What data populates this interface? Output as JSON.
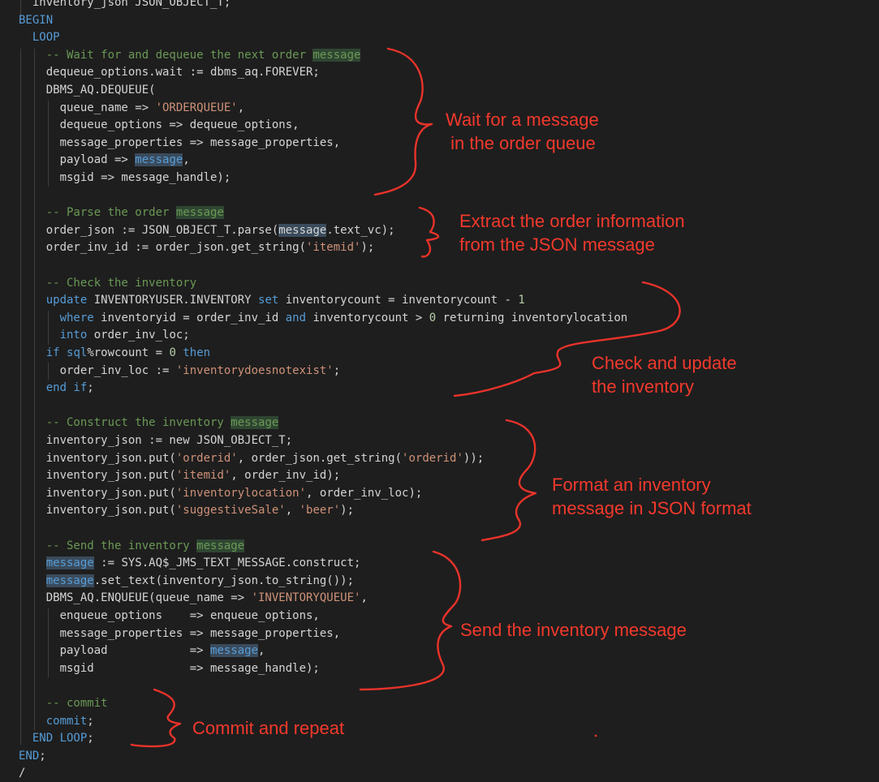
{
  "editor": {
    "lines": [
      [
        {
          "t": "  inventory_json JSON_OBJECT_T;",
          "c": ""
        }
      ],
      [
        {
          "t": "BEGIN",
          "c": "kw"
        }
      ],
      [
        {
          "t": "  ",
          "c": ""
        },
        {
          "t": "LOOP",
          "c": "kw"
        }
      ],
      [
        {
          "t": "    -- Wait for and dequeue the next order ",
          "c": "cm"
        },
        {
          "t": "message",
          "c": "cm hlc"
        }
      ],
      [
        {
          "t": "    dequeue_options.wait := dbms_aq.FOREVER;",
          "c": ""
        }
      ],
      [
        {
          "t": "    DBMS_AQ.DEQUEUE(",
          "c": ""
        }
      ],
      [
        {
          "t": "      queue_name => ",
          "c": ""
        },
        {
          "t": "'ORDERQUEUE'",
          "c": "str"
        },
        {
          "t": ",",
          "c": ""
        }
      ],
      [
        {
          "t": "      dequeue_options => dequeue_options,",
          "c": ""
        }
      ],
      [
        {
          "t": "      message_properties => message_properties,",
          "c": ""
        }
      ],
      [
        {
          "t": "      payload => ",
          "c": ""
        },
        {
          "t": "message",
          "c": "kw hl"
        },
        {
          "t": ",",
          "c": ""
        }
      ],
      [
        {
          "t": "      msgid => message_handle);",
          "c": ""
        }
      ],
      [
        {
          "t": "",
          "c": ""
        }
      ],
      [
        {
          "t": "    -- Parse the order ",
          "c": "cm"
        },
        {
          "t": "message",
          "c": "cm hlc"
        }
      ],
      [
        {
          "t": "    order_json := JSON_OBJECT_T.parse(",
          "c": ""
        },
        {
          "t": "message",
          "c": "hl"
        },
        {
          "t": ".text_vc);",
          "c": ""
        }
      ],
      [
        {
          "t": "    order_inv_id := order_json.get_string(",
          "c": ""
        },
        {
          "t": "'itemid'",
          "c": "str"
        },
        {
          "t": ");",
          "c": ""
        }
      ],
      [
        {
          "t": "",
          "c": ""
        }
      ],
      [
        {
          "t": "    -- Check the inventory",
          "c": "cm"
        }
      ],
      [
        {
          "t": "    ",
          "c": ""
        },
        {
          "t": "update",
          "c": "kw"
        },
        {
          "t": " INVENTORYUSER.INVENTORY ",
          "c": ""
        },
        {
          "t": "set",
          "c": "kw"
        },
        {
          "t": " inventorycount = inventorycount - ",
          "c": ""
        },
        {
          "t": "1",
          "c": "num"
        }
      ],
      [
        {
          "t": "      ",
          "c": ""
        },
        {
          "t": "where",
          "c": "kw"
        },
        {
          "t": " inventoryid = order_inv_id ",
          "c": ""
        },
        {
          "t": "and",
          "c": "kw"
        },
        {
          "t": " inventorycount > ",
          "c": ""
        },
        {
          "t": "0",
          "c": "num"
        },
        {
          "t": " returning inventorylocation",
          "c": ""
        }
      ],
      [
        {
          "t": "      ",
          "c": ""
        },
        {
          "t": "into",
          "c": "kw"
        },
        {
          "t": " order_inv_loc;",
          "c": ""
        }
      ],
      [
        {
          "t": "    ",
          "c": ""
        },
        {
          "t": "if",
          "c": "kw"
        },
        {
          "t": " ",
          "c": ""
        },
        {
          "t": "sql",
          "c": "kw"
        },
        {
          "t": "%rowcount = ",
          "c": ""
        },
        {
          "t": "0",
          "c": "num"
        },
        {
          "t": " ",
          "c": ""
        },
        {
          "t": "then",
          "c": "kw"
        }
      ],
      [
        {
          "t": "      order_inv_loc := ",
          "c": ""
        },
        {
          "t": "'inventorydoesnotexist'",
          "c": "str"
        },
        {
          "t": ";",
          "c": ""
        }
      ],
      [
        {
          "t": "    ",
          "c": ""
        },
        {
          "t": "end if",
          "c": "kw"
        },
        {
          "t": ";",
          "c": ""
        }
      ],
      [
        {
          "t": "",
          "c": ""
        }
      ],
      [
        {
          "t": "    -- Construct the inventory ",
          "c": "cm"
        },
        {
          "t": "message",
          "c": "cm hlc"
        }
      ],
      [
        {
          "t": "    inventory_json := new JSON_OBJECT_T;",
          "c": ""
        }
      ],
      [
        {
          "t": "    inventory_json.put(",
          "c": ""
        },
        {
          "t": "'orderid'",
          "c": "str"
        },
        {
          "t": ", order_json.get_string(",
          "c": ""
        },
        {
          "t": "'orderid'",
          "c": "str"
        },
        {
          "t": "));",
          "c": ""
        }
      ],
      [
        {
          "t": "    inventory_json.put(",
          "c": ""
        },
        {
          "t": "'itemid'",
          "c": "str"
        },
        {
          "t": ", order_inv_id);",
          "c": ""
        }
      ],
      [
        {
          "t": "    inventory_json.put(",
          "c": ""
        },
        {
          "t": "'inventorylocation'",
          "c": "str"
        },
        {
          "t": ", order_inv_loc);",
          "c": ""
        }
      ],
      [
        {
          "t": "    inventory_json.put(",
          "c": ""
        },
        {
          "t": "'suggestiveSale'",
          "c": "str"
        },
        {
          "t": ", ",
          "c": ""
        },
        {
          "t": "'beer'",
          "c": "str"
        },
        {
          "t": ");",
          "c": ""
        }
      ],
      [
        {
          "t": "",
          "c": ""
        }
      ],
      [
        {
          "t": "    -- Send the inventory ",
          "c": "cm"
        },
        {
          "t": "message",
          "c": "cm hlc"
        }
      ],
      [
        {
          "t": "    ",
          "c": ""
        },
        {
          "t": "message",
          "c": "kw hl"
        },
        {
          "t": " := SYS.AQ$_JMS_TEXT_MESSAGE.construct;",
          "c": ""
        }
      ],
      [
        {
          "t": "    ",
          "c": ""
        },
        {
          "t": "message",
          "c": "kw hl"
        },
        {
          "t": ".set_text(inventory_json.to_string());",
          "c": ""
        }
      ],
      [
        {
          "t": "    DBMS_AQ.ENQUEUE(queue_name => ",
          "c": ""
        },
        {
          "t": "'INVENTORYQUEUE'",
          "c": "str"
        },
        {
          "t": ",",
          "c": ""
        }
      ],
      [
        {
          "t": "      enqueue_options    => enqueue_options,",
          "c": ""
        }
      ],
      [
        {
          "t": "      message_properties => message_properties,",
          "c": ""
        }
      ],
      [
        {
          "t": "      payload            => ",
          "c": ""
        },
        {
          "t": "message",
          "c": "kw hl"
        },
        {
          "t": ",",
          "c": ""
        }
      ],
      [
        {
          "t": "      msgid              => message_handle);",
          "c": ""
        }
      ],
      [
        {
          "t": "",
          "c": ""
        }
      ],
      [
        {
          "t": "    -- commit",
          "c": "cm"
        }
      ],
      [
        {
          "t": "    ",
          "c": ""
        },
        {
          "t": "commit",
          "c": "kw"
        },
        {
          "t": ";",
          "c": ""
        }
      ],
      [
        {
          "t": "  ",
          "c": ""
        },
        {
          "t": "END LOOP",
          "c": "kw"
        },
        {
          "t": ";",
          "c": ""
        }
      ],
      [
        {
          "t": "END",
          "c": "kw"
        },
        {
          "t": ";",
          "c": ""
        }
      ],
      [
        {
          "t": "/",
          "c": ""
        }
      ]
    ]
  },
  "annotations": {
    "color": "#e8332a",
    "notes": [
      {
        "id": "wait",
        "text": "Wait for a message\n in the order queue"
      },
      {
        "id": "extract",
        "text": "Extract the order information\nfrom the JSON message"
      },
      {
        "id": "check",
        "text": "Check and update\nthe inventory"
      },
      {
        "id": "format",
        "text": "Format an inventory\nmessage in JSON format"
      },
      {
        "id": "send",
        "text": "Send the inventory message"
      },
      {
        "id": "commit",
        "text": "Commit and repeat"
      }
    ]
  },
  "colors": {
    "background": "#1e1e1e",
    "text": "#d4d4d4",
    "keyword": "#569cd6",
    "string": "#ce9178",
    "comment": "#6a9955",
    "number": "#b5cea8",
    "annotation": "#f2392c"
  }
}
